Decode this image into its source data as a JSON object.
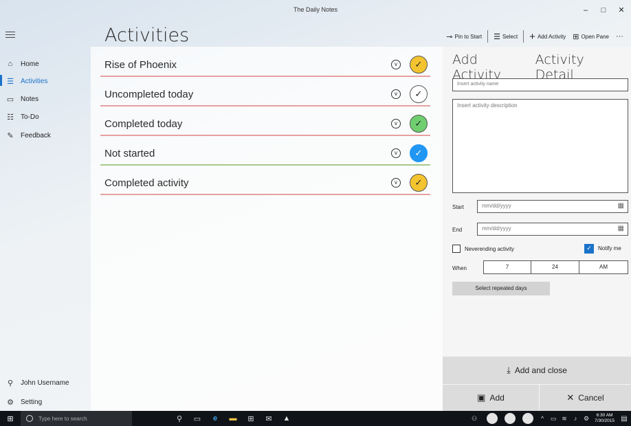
{
  "window": {
    "title": "The Daily Notes",
    "minimize": "–",
    "maximize": "□",
    "close": "✕"
  },
  "sidebar": {
    "items": [
      {
        "label": "Home",
        "icon": "⌂"
      },
      {
        "label": "Activities",
        "icon": "☰"
      },
      {
        "label": "Notes",
        "icon": "▭"
      },
      {
        "label": "To-Do",
        "icon": "☷"
      },
      {
        "label": "Feedback",
        "icon": "✎"
      }
    ],
    "user": {
      "label": "John Username",
      "icon": "⚲"
    },
    "settings": {
      "label": "Setting",
      "icon": "⚙"
    }
  },
  "page": {
    "title": "Activities"
  },
  "commands": {
    "pin": {
      "label": "Pin to Start",
      "icon": "⊸"
    },
    "select": {
      "label": "Select",
      "icon": "☰"
    },
    "add": {
      "label": "Add Activity",
      "icon": "+"
    },
    "pane": {
      "label": "Open Pane",
      "icon": "⊞"
    },
    "more": "···"
  },
  "activities": [
    {
      "name": "Rise of Phoenix",
      "status_color": "#f4c430",
      "line_color": "#e8a0a0",
      "check_fill": "#f4c430"
    },
    {
      "name": "Uncompleted today",
      "status_color": "#ffffff",
      "line_color": "#e8a0a0",
      "check_fill": "#ffffff"
    },
    {
      "name": "Completed today",
      "status_color": "#6fcf6f",
      "line_color": "#e8a0a0",
      "check_fill": "#6fcf6f"
    },
    {
      "name": "Not started",
      "status_color": "#2196f3",
      "line_color": "#a8c98a",
      "check_fill": "#2196f3"
    },
    {
      "name": "Completed activity",
      "status_color": "#f4c430",
      "line_color": "#e8a0a0",
      "check_fill": "#f4c430"
    }
  ],
  "detail": {
    "tabs": [
      "Add Activity",
      "Activity Detail"
    ],
    "name_placeholder": "Insert activity name",
    "desc_placeholder": "Insert activity description",
    "start_label": "Start",
    "end_label": "End",
    "date_placeholder": "mm/dd/yyyy",
    "neverending_label": "Neverending activity",
    "notify_label": "Notify me",
    "when_label": "When",
    "time": {
      "hour": "7",
      "minute": "24",
      "period": "AM"
    },
    "repeat_button": "Select repeated days",
    "add_close_button": "Add and close",
    "add_button": "Add",
    "cancel_button": "Cancel"
  },
  "taskbar": {
    "search_placeholder": "Type here to search",
    "clock_time": "6:30 AM",
    "clock_date": "7/30/2015"
  }
}
